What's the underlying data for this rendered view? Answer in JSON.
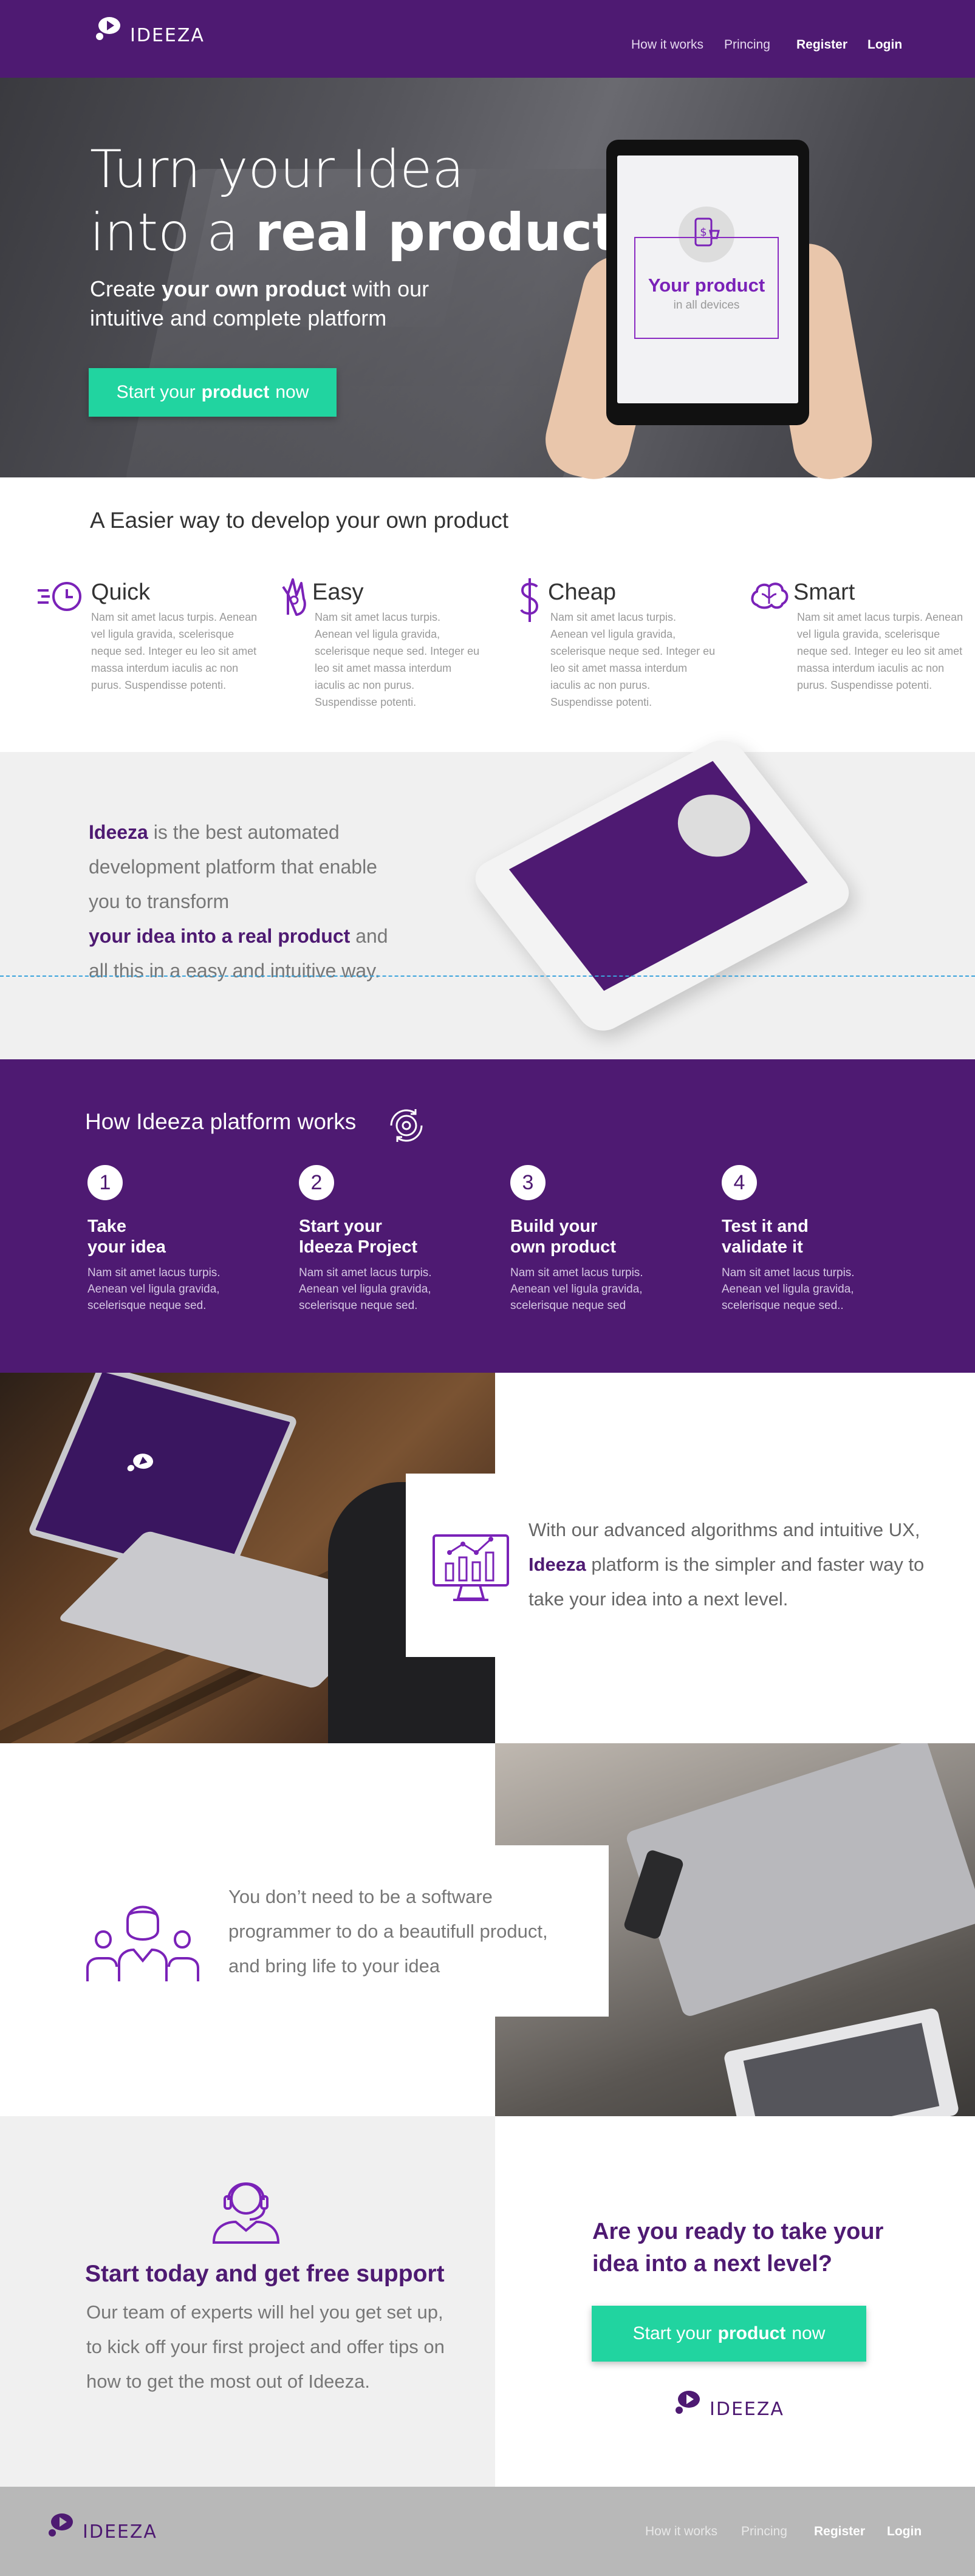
{
  "brand": {
    "name": "IDEEZA",
    "primary": "#4e1a72",
    "accent": "#21d4a0"
  },
  "nav": {
    "links": [
      "How it works",
      "Princing",
      "Register",
      "Login"
    ]
  },
  "hero": {
    "line1": "Turn your Idea",
    "line2_pre": "into a ",
    "line2_bold": "real product",
    "sub_pre": "Create ",
    "sub_bold": "your own product",
    "sub_post": " with our intuitive and complete platform",
    "cta": {
      "pre": "Start your",
      "bold": "product",
      "post": "now"
    },
    "tablet": {
      "title": "Your product",
      "sub": "in all devices"
    }
  },
  "easier": {
    "title": "A Easier way to develop your own product",
    "features": [
      {
        "title": "Quick",
        "icon": "stopwatch-icon",
        "text": "Nam sit amet lacus turpis. Aenean vel ligula gravida, scelerisque neque sed. Integer eu leo sit amet massa interdum iaculis ac non purus. Suspendisse potenti."
      },
      {
        "title": "Easy",
        "icon": "ok-hand-icon",
        "text": "Nam sit amet lacus turpis. Aenean vel ligula gravida, scelerisque neque sed. Integer eu leo sit amet massa interdum iaculis ac non purus. Suspendisse potenti."
      },
      {
        "title": "Cheap",
        "icon": "dollar-icon",
        "text": "Nam sit amet lacus turpis. Aenean vel ligula gravida, scelerisque neque sed. Integer eu leo sit amet massa interdum iaculis ac non purus. Suspendisse potenti."
      },
      {
        "title": "Smart",
        "icon": "brain-icon",
        "text": "Nam sit amet lacus turpis. Aenean vel ligula gravida, scelerisque neque sed. Integer eu leo sit amet massa interdum iaculis ac non purus. Suspendisse potenti."
      }
    ]
  },
  "about": {
    "brand": "Ideeza",
    "t1": " is the best automated development platform that enable you to transform",
    "bold2": "your idea into a real product",
    "t2": " and all this in a easy and intuitive way."
  },
  "how": {
    "title": "How Ideeza platform works",
    "steps": [
      {
        "num": "1",
        "title": "Take\nyour idea",
        "text": "Nam sit amet lacus turpis. Aenean vel ligula gravida, scelerisque neque sed."
      },
      {
        "num": "2",
        "title": "Start your\nIdeeza Project",
        "text": "Nam sit amet lacus turpis. Aenean vel ligula gravida, scelerisque neque sed."
      },
      {
        "num": "3",
        "title": "Build your\nown product",
        "text": "Nam sit amet lacus turpis. Aenean vel ligula gravida, scelerisque neque sed"
      },
      {
        "num": "4",
        "title": "Test it and\nvalidate it",
        "text": "Nam sit amet lacus turpis. Aenean vel ligula gravida, scelerisque neque sed.."
      }
    ]
  },
  "algo": {
    "pre": "With our advanced algorithms and intuitive UX, ",
    "brand": "Ideeza",
    "post": " platform is the simpler and faster  way to take your idea into a next level."
  },
  "team": {
    "text": "You don’t need to be a software programmer to do a beautifull product, and bring life to your idea"
  },
  "support": {
    "title": "Start today and get free support",
    "text": "Our team of experts will hel you get set up, to kick off your first project and offer tips on how to get the most out of Ideeza."
  },
  "ready": {
    "title": "Are you ready to take your idea into a next level?",
    "cta": {
      "pre": "Start your",
      "bold": "product",
      "post": "now"
    }
  },
  "footer": {
    "links": [
      "How it works",
      "Princing",
      "Register",
      "Login"
    ]
  }
}
